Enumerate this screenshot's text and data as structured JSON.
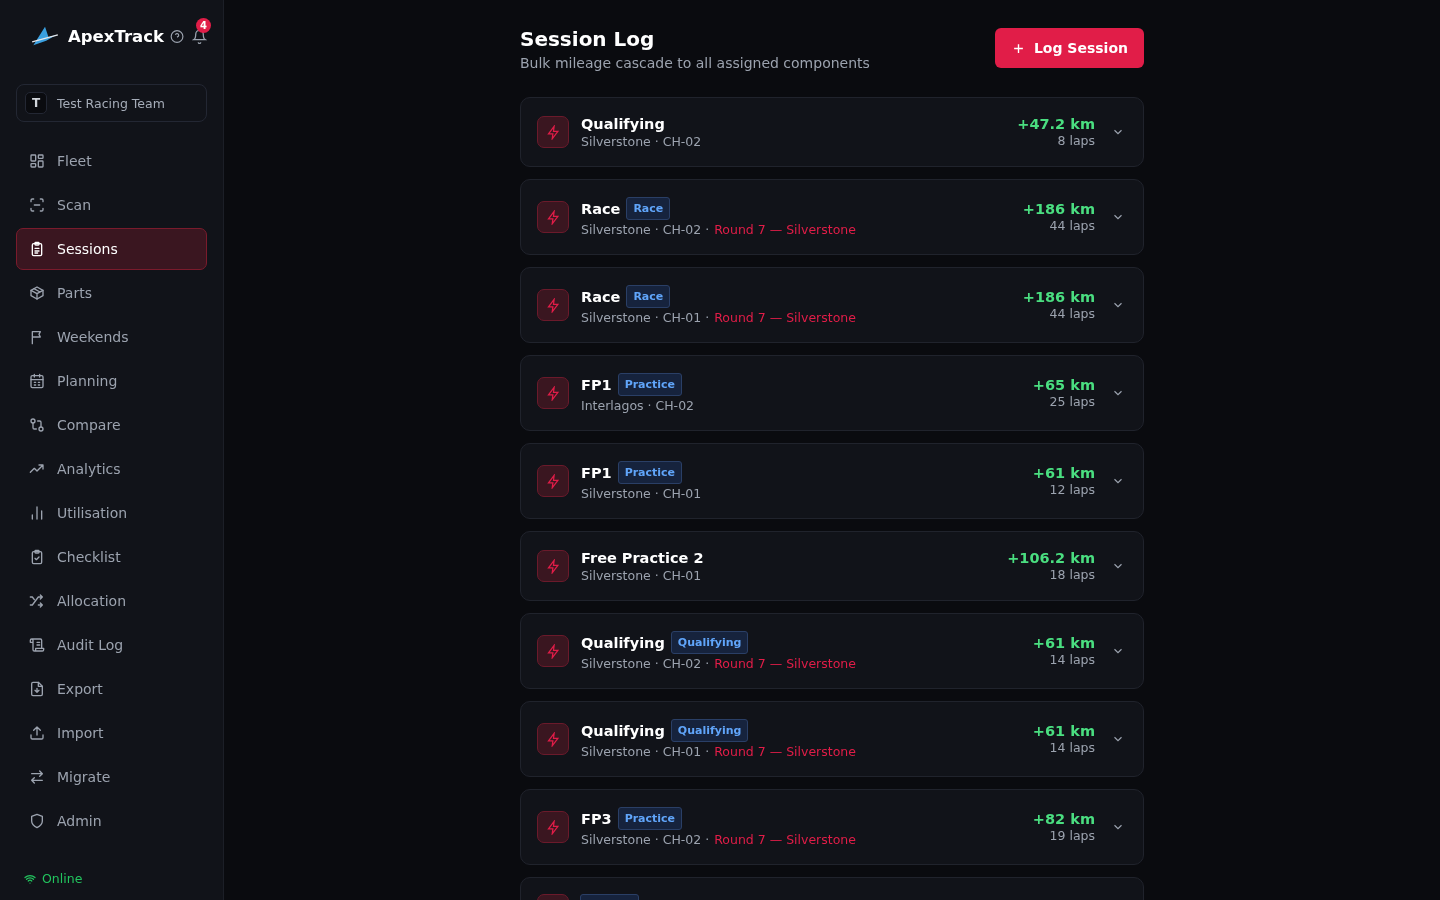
{
  "sidebar": {
    "brand": "ApexTrack",
    "notifications": "4",
    "team": {
      "initial": "T",
      "name": "Test Racing Team"
    },
    "items": [
      {
        "label": "Fleet",
        "selected": false
      },
      {
        "label": "Scan",
        "selected": false
      },
      {
        "label": "Sessions",
        "selected": true
      },
      {
        "label": "Parts",
        "selected": false
      },
      {
        "label": "Weekends",
        "selected": false
      },
      {
        "label": "Planning",
        "selected": false
      },
      {
        "label": "Compare",
        "selected": false
      },
      {
        "label": "Analytics",
        "selected": false
      },
      {
        "label": "Utilisation",
        "selected": false
      },
      {
        "label": "Checklist",
        "selected": false
      },
      {
        "label": "Allocation",
        "selected": false
      },
      {
        "label": "Audit Log",
        "selected": false
      },
      {
        "label": "Export",
        "selected": false
      },
      {
        "label": "Import",
        "selected": false
      },
      {
        "label": "Migrate",
        "selected": false
      },
      {
        "label": "Admin",
        "selected": false
      }
    ],
    "status": "Online"
  },
  "header": {
    "title": "Session Log",
    "subtitle": "Bulk mileage cascade to all assigned components",
    "button": "Log Session"
  },
  "sessions": [
    {
      "title": "Qualifying",
      "meta": "Silverstone · CH-02",
      "distance": "+47.2 km",
      "laps": "8 laps"
    },
    {
      "title": "Race",
      "badge": "Race",
      "meta": "Silverstone · CH-02 ·",
      "round": "Round 7 — Silverstone",
      "distance": "+186 km",
      "laps": "44 laps"
    },
    {
      "title": "Race",
      "badge": "Race",
      "meta": "Silverstone · CH-01 ·",
      "round": "Round 7 — Silverstone",
      "distance": "+186 km",
      "laps": "44 laps"
    },
    {
      "title": "FP1",
      "badge": "Practice",
      "meta": "Interlagos · CH-02",
      "distance": "+65 km",
      "laps": "25 laps"
    },
    {
      "title": "FP1",
      "badge": "Practice",
      "meta": "Silverstone · CH-01",
      "distance": "+61 km",
      "laps": "12 laps"
    },
    {
      "title": "Free Practice 2",
      "meta": "Silverstone · CH-01",
      "distance": "+106.2 km",
      "laps": "18 laps"
    },
    {
      "title": "Qualifying",
      "badge": "Qualifying",
      "meta": "Silverstone · CH-02 ·",
      "round": "Round 7 — Silverstone",
      "distance": "+61 km",
      "laps": "14 laps"
    },
    {
      "title": "Qualifying",
      "badge": "Qualifying",
      "meta": "Silverstone · CH-01 ·",
      "round": "Round 7 — Silverstone",
      "distance": "+61 km",
      "laps": "14 laps"
    },
    {
      "title": "FP3",
      "badge": "Practice",
      "meta": "Silverstone · CH-02 ·",
      "round": "Round 7 — Silverstone",
      "distance": "+82 km",
      "laps": "19 laps"
    },
    {
      "kind": "cut"
    }
  ]
}
